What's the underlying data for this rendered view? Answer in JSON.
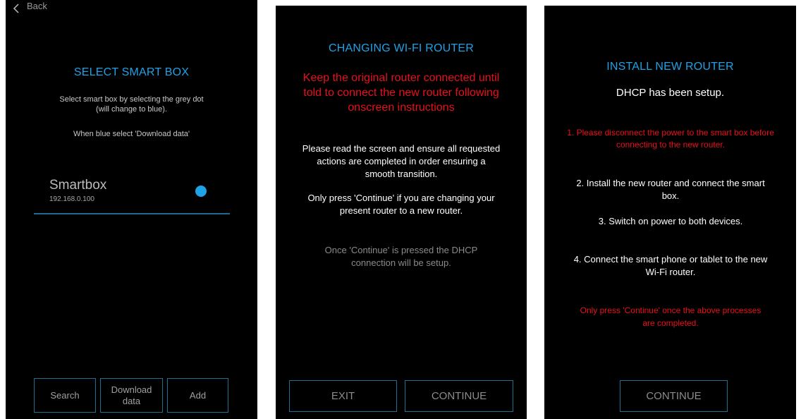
{
  "screen1": {
    "back_label": "Back",
    "title": "SELECT SMART BOX",
    "instruction1": "Select smart box by selecting the grey dot (will change to blue).",
    "instruction2": "When blue select 'Download data'",
    "device_name": "Smartbox",
    "device_ip": "192.168.0.100",
    "selected_dot_color": "#1fa2e6",
    "buttons": {
      "search": "Search",
      "download_data": "Download data",
      "add": "Add"
    }
  },
  "screen2": {
    "title": "CHANGING WI-FI ROUTER",
    "warning": "Keep the original router connected until told to connect the new router following onscreen instructions",
    "paragraph1": "Please read the screen and ensure all requested actions are completed in order ensuring a smooth transition.",
    "paragraph2": "Only press 'Continue' if you are changing your present router to a new router.",
    "note": "Once 'Continue' is pressed the DHCP connection will be setup.",
    "buttons": {
      "exit": "EXIT",
      "continue": "CONTINUE"
    }
  },
  "screen3": {
    "title": "INSTALL NEW ROUTER",
    "subtitle": "DHCP has been setup.",
    "step1": "1. Please disconnect the power to the smart box before connecting to the new router.",
    "step2": "2. Install the new router and connect the smart box.",
    "step3": "3. Switch on power to both devices.",
    "step4": "4. Connect the smart phone or tablet to the new Wi-Fi router.",
    "final_note": "Only press 'Continue' once the above processes are completed.",
    "buttons": {
      "continue": "CONTINUE"
    }
  },
  "colors": {
    "accent_blue": "#1fa2e6",
    "warning_red": "#e8101a",
    "button_border": "#1e6f94",
    "background": "#000000"
  }
}
